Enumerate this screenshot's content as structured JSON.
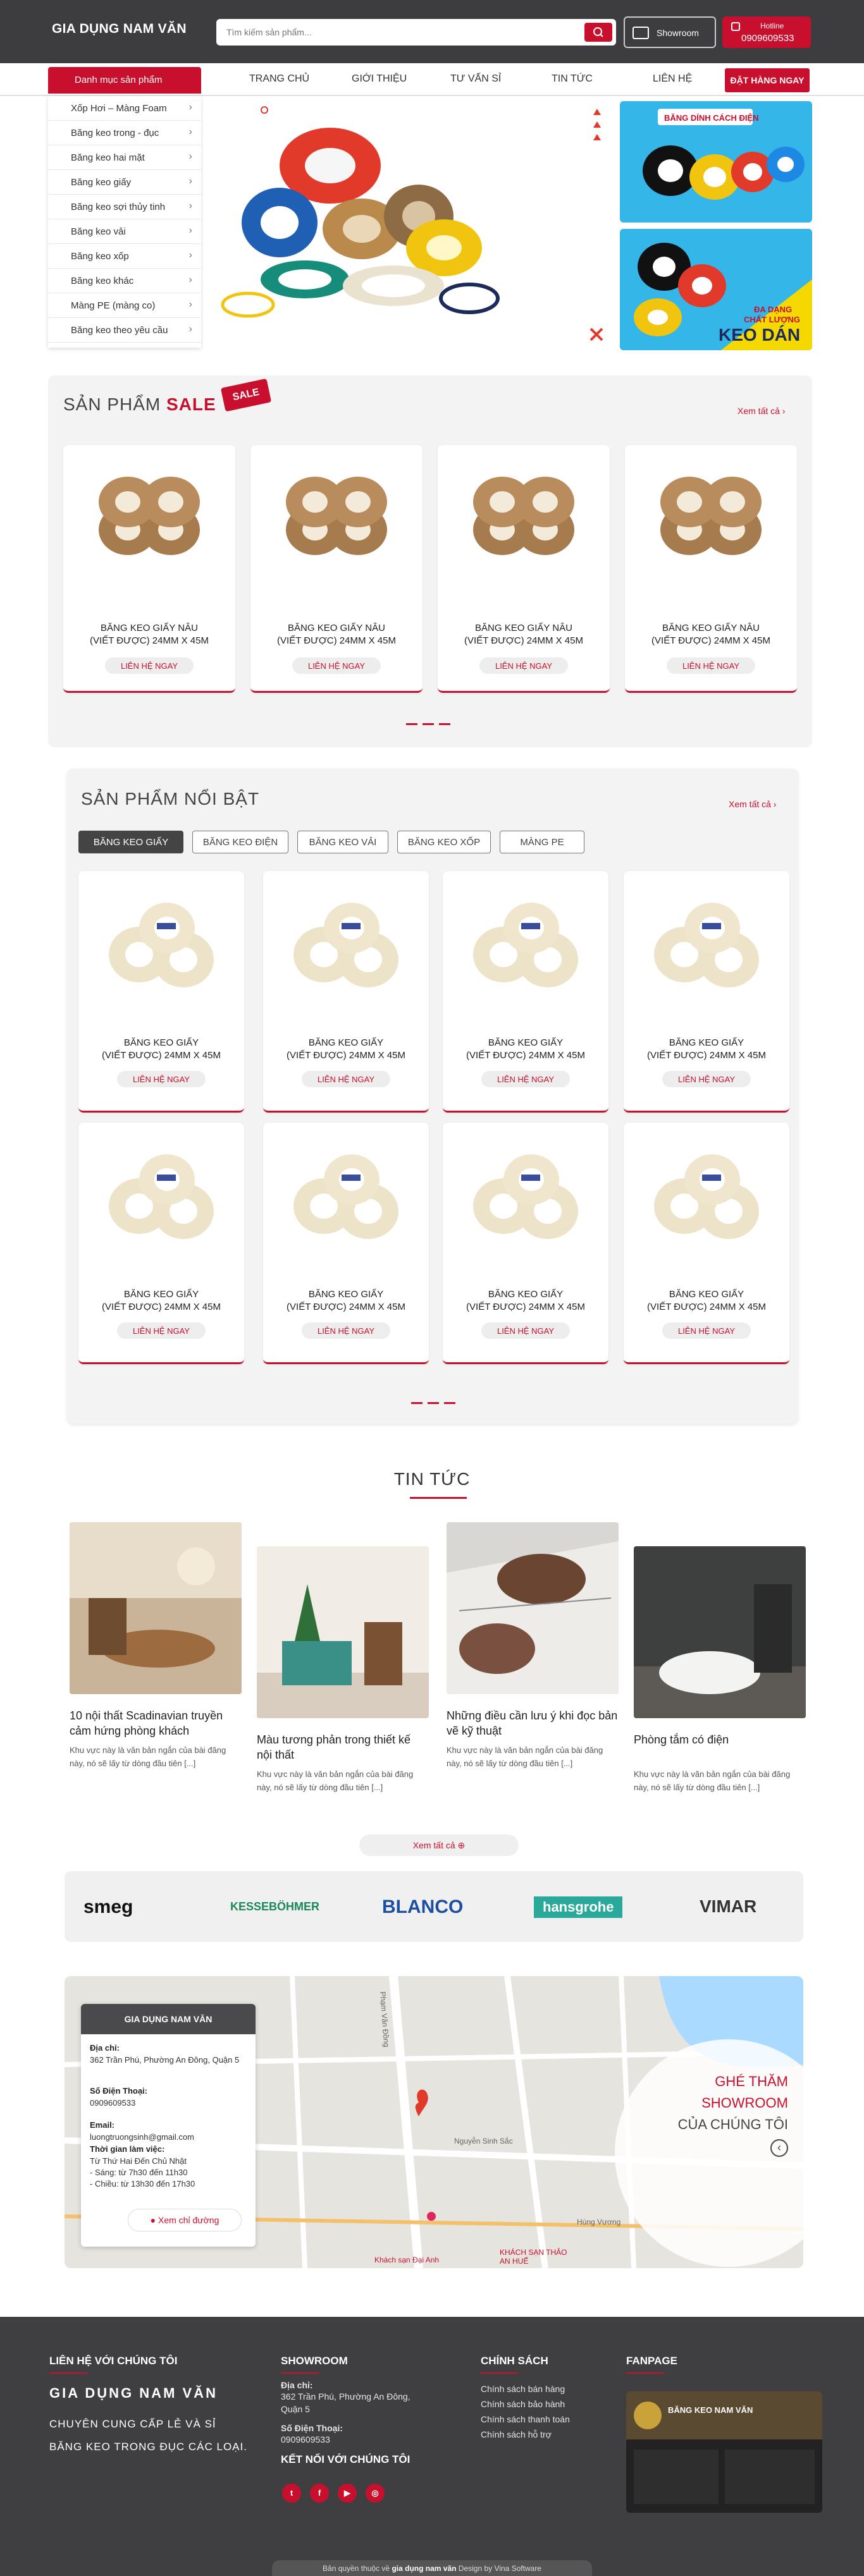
{
  "header": {
    "logo": "GIA DỤNG NAM VĂN",
    "search_placeholder": "Tìm kiếm sản phẩm...",
    "showroom_label": "Showroom",
    "hotline_label": "Hotline",
    "hotline_number": "0909609533"
  },
  "nav": {
    "category_label": "Danh mục sản phẩm",
    "items": [
      "TRANG CHỦ",
      "GIỚI THIỆU",
      "TƯ VẤN SỈ",
      "TIN TỨC",
      "LIÊN HỆ"
    ],
    "order_button": "ĐẶT HÀNG NGAY"
  },
  "categories": [
    "Xốp Hơi – Màng Foam",
    "Băng keo trong - đục",
    "Băng keo hai mặt",
    "Băng keo giấy",
    "Băng keo sợi thủy tinh",
    "Băng keo vải",
    "Băng keo xốp",
    "Băng keo khác",
    "Màng PE (màng co)",
    "Băng keo theo yêu cầu"
  ],
  "banners": {
    "b1_title": "BĂNG DÍNH CÁCH ĐIỆN",
    "b2_line1": "ĐA DẠNG",
    "b2_line2": "CHẤT LƯỢNG",
    "b2_line3": "KEO DÁN"
  },
  "sale": {
    "title_prefix": "SẢN PHẨM",
    "title_highlight": "SALE",
    "badge": "SALE",
    "see_all": "Xem tất cả ›",
    "products": [
      {
        "name1": "BĂNG KEO GIẤY NÂU",
        "name2": "(VIẾT ĐƯỢC) 24MM X 45M",
        "button": "LIÊN HỆ NGAY"
      },
      {
        "name1": "BĂNG KEO GIẤY NÂU",
        "name2": "(VIẾT ĐƯỢC) 24MM X 45M",
        "button": "LIÊN HỆ NGAY"
      },
      {
        "name1": "BĂNG KEO GIẤY NÂU",
        "name2": "(VIẾT ĐƯỢC) 24MM X 45M",
        "button": "LIÊN HỆ NGAY"
      },
      {
        "name1": "BĂNG KEO GIẤY NÂU",
        "name2": "(VIẾT ĐƯỢC) 24MM X 45M",
        "button": "LIÊN HỆ NGAY"
      }
    ]
  },
  "featured": {
    "title": "SẢN PHẨM NỔI BẬT",
    "see_all": "Xem tất cả ›",
    "tabs": [
      "BĂNG KEO GIẤY",
      "BĂNG KEO ĐIỆN",
      "BĂNG KEO VẢI",
      "BĂNG KEO XỐP",
      "MÀNG PE"
    ],
    "product_name1": "BĂNG KEO GIẤY",
    "product_name2": "(VIẾT ĐƯỢC) 24MM X 45M",
    "button": "LIÊN HỆ NGAY"
  },
  "news": {
    "title": "TIN TỨC",
    "items": [
      {
        "title": "10 nội thất Scadinavian truyền cảm hứng phòng khách",
        "desc": "Khu vực này là văn bản ngắn của bài đăng này, nó sẽ lấy từ dòng đầu tiên [...]"
      },
      {
        "title": "Màu tương phản trong thiết kế nội thất",
        "desc": "Khu vực này là văn bản ngắn của bài đăng này, nó sẽ lấy từ dòng đầu tiên [...]"
      },
      {
        "title": "Những điều cần lưu ý khi đọc bản vẽ kỹ thuật",
        "desc": "Khu vực này là văn bản ngắn của bài đăng này, nó sẽ lấy từ dòng đầu tiên [...]"
      },
      {
        "title": "Phòng tắm có điện",
        "desc": "Khu vực này là văn bản ngắn của bài đăng này, nó sẽ lấy từ dòng đầu tiên [...]"
      }
    ],
    "more": "Xem tất cả ⊕"
  },
  "brands": [
    "smeg",
    "KESSEBÖHMER",
    "BLANCO",
    "hansgrohe",
    "VIMAR"
  ],
  "brand_colors": {
    "smeg": "#111111",
    "kesseb": "#1a8a5a",
    "blanco": "#1d4fa0",
    "hansgrohe": "#2aa89a",
    "vimar": "#333333"
  },
  "map": {
    "card_title": "GIA DỤNG NAM VĂN",
    "address_label": "Địa chỉ:",
    "address": "362 Trần Phú, Phường An Đông, Quận 5",
    "phone_label": "Số Điện Thoại:",
    "phone": "0909609533",
    "email_label": "Email:",
    "email": "luongtruongsinh@gmail.com",
    "hours_label": "Thời gian làm việc:",
    "hours1": "Từ Thứ Hai Đến Chủ Nhật",
    "hours2": "- Sáng: từ 7h30 đến 11h30",
    "hours3": "- Chiều: từ 13h30 đến 17h30",
    "directions": "Xem chỉ đường",
    "visit1": "GHÉ THĂM",
    "visit2": "SHOWROOM",
    "visit3": "CỦA CHÚNG TÔI",
    "street_labels": [
      "Phạm Văn Đồng",
      "Nguyễn Sinh Sắc",
      "Hùng Vương",
      "Khách sạn Đại Anh",
      "KHÁCH SẠN THẢO AN HUẾ"
    ]
  },
  "footer": {
    "contact_heading": "LIÊN HỆ VỚI CHÚNG TÔI",
    "brand": "GIA DỤNG NAM VĂN",
    "tagline1": "CHUYÊN CUNG CẤP LẺ VÀ SỈ",
    "tagline2": "BĂNG KEO TRONG ĐỤC CÁC LOẠI.",
    "showroom_heading": "SHOWROOM",
    "address_label": "Địa chỉ:",
    "address": "362 Trần Phú, Phường An Đông, Quận 5",
    "phone_label": "Số Điện Thoại:",
    "phone": "0909609533",
    "connect_heading": "KẾT NỐI VỚI CHÚNG TÔI",
    "policy_heading": "CHÍNH SÁCH",
    "policies": [
      "Chính sách bán hàng",
      "Chính sách bảo hành",
      "Chính sách thanh toán",
      "Chính sách hỗ trợ"
    ],
    "fanpage_heading": "FANPAGE",
    "fanpage_name": "BĂNG KEO NAM VĂN",
    "copyright_pre": "Bản quyền thuộc về",
    "copyright_site": "gia dụng nam văn",
    "copyright_post": "Design by Vina Software"
  }
}
